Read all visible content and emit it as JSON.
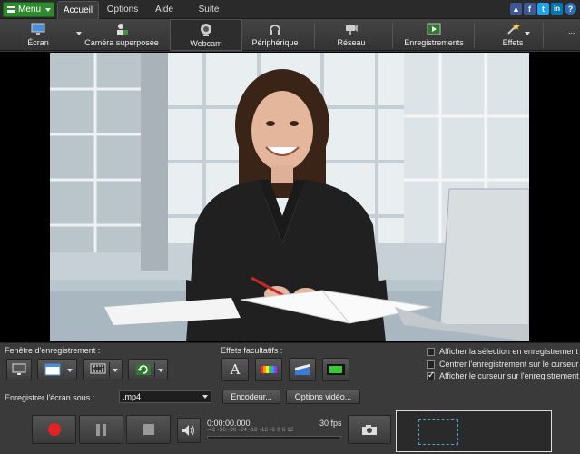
{
  "menubar": {
    "menu_label": "Menu",
    "tabs": [
      {
        "label": "Accueil",
        "active": true
      },
      {
        "label": "Options",
        "active": false
      },
      {
        "label": "Aide",
        "active": false
      },
      {
        "label": "Suite",
        "active": false
      }
    ],
    "social": [
      {
        "name": "like-icon",
        "glyph": "👍",
        "color": "#3b5998"
      },
      {
        "name": "facebook-icon",
        "glyph": "f",
        "color": "#3b5998"
      },
      {
        "name": "twitter-icon",
        "glyph": "t",
        "color": "#1da1f2"
      },
      {
        "name": "linkedin-icon",
        "glyph": "in",
        "color": "#0077b5"
      },
      {
        "name": "help-icon",
        "glyph": "?",
        "color": "#2d6db5"
      }
    ]
  },
  "toolbar": {
    "items": [
      {
        "label": "Écran"
      },
      {
        "label": "Caméra superposée"
      },
      {
        "label": "Webcam"
      },
      {
        "label": "Périphérique"
      },
      {
        "label": "Réseau"
      },
      {
        "label": "Enregistrements"
      },
      {
        "label": "Effets"
      }
    ],
    "more": "..."
  },
  "panel": {
    "recording_window_label": "Fenêtre d'enregistrement :",
    "optional_effects_label": "Effets facultatifs :",
    "save_as_label": "Enregistrer l'écran sous :",
    "format_value": ".mp4",
    "encoder_button": "Encodeur...",
    "video_options_button": "Options vidéo...",
    "checkboxes": [
      {
        "label": "Afficher la sélection en enregistrement",
        "checked": false
      },
      {
        "label": "Centrer l'enregistrement sur le curseur",
        "checked": false
      },
      {
        "label": "Afficher le curseur sur l'enregistrement",
        "checked": true
      }
    ],
    "timer": "0:00:00.000",
    "fps": "30 fps",
    "level_scale": "-42  -36  -30  -24  -18  -12   -6   0   6   12"
  }
}
